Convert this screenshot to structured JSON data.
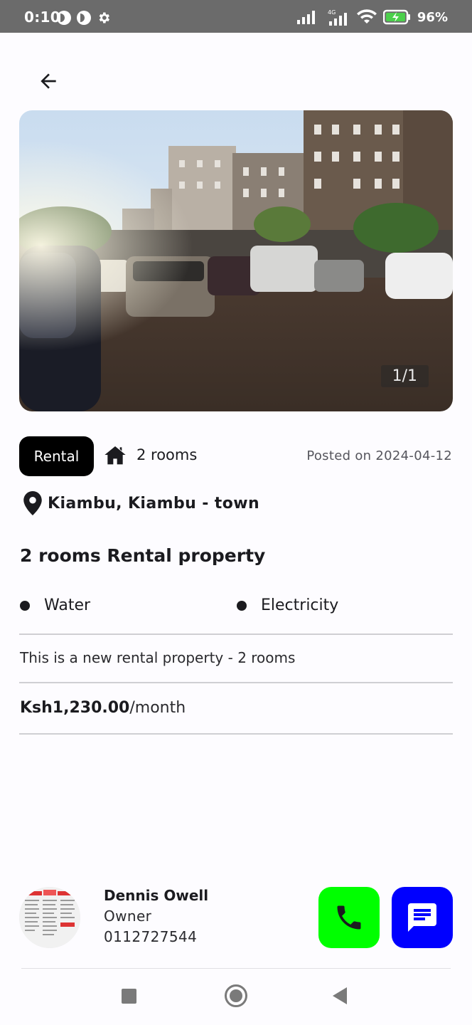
{
  "status_bar": {
    "time": "0:10",
    "battery": "96%",
    "network": "4G"
  },
  "header": {
    "back_icon": "arrow-left-icon"
  },
  "gallery": {
    "counter": "1/1"
  },
  "listing": {
    "type_chip": "Rental",
    "rooms": "2 rooms",
    "posted": "Posted on 2024-04-12",
    "location": "Kiambu, Kiambu - town",
    "title": "2 rooms Rental property",
    "amenities": [
      "Water",
      "Electricity"
    ],
    "description": "This is a new rental property - 2 rooms",
    "price": "Ksh1,230.00",
    "price_unit": "/month"
  },
  "owner": {
    "name": "Dennis Owell",
    "role": "Owner",
    "phone": "0112727544"
  },
  "colors": {
    "call": "#00ff00",
    "chat": "#0000ff",
    "chip": "#000000"
  }
}
